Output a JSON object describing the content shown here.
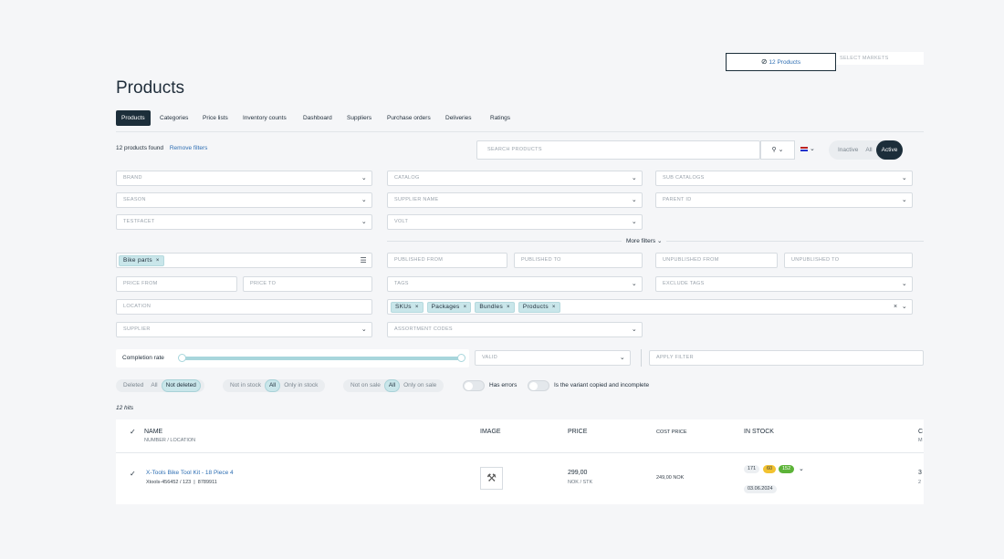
{
  "header": {
    "product_count_label": "12 Products",
    "markets_placeholder": "SELECT MARKETS"
  },
  "page_title": "Products",
  "tabs": [
    "Products",
    "Categories",
    "Price lists",
    "Inventory counts",
    "Dashboard",
    "Suppliers",
    "Purchase orders",
    "Deliveries",
    "Ratings"
  ],
  "results": {
    "found_label": "12 products found",
    "remove_filters": "Remove filters",
    "search_placeholder": "SEARCH PRODUCTS",
    "hits": "12 hits"
  },
  "status_toggle": {
    "options": [
      "Inactive",
      "All",
      "Active"
    ],
    "selected": "Active"
  },
  "filters": {
    "brand": "BRAND",
    "catalog": "CATALOG",
    "sub_catalogs": "SUB CATALOGS",
    "season": "SEASON",
    "supplier_name": "SUPPLIER NAME",
    "parent_id": "PARENT ID",
    "testfacet": "TESTFACET",
    "volt": "VOLT",
    "more_filters": "More filters",
    "category_chip": "Bike parts",
    "published_from": "PUBLISHED FROM",
    "published_to": "PUBLISHED TO",
    "unpublished_from": "UNPUBLISHED FROM",
    "unpublished_to": "UNPUBLISHED TO",
    "price_from": "PRICE FROM",
    "price_to": "PRICE TO",
    "tags": "TAGS",
    "exclude_tags": "EXCLUDE TAGS",
    "location": "LOCATION",
    "type_chips": [
      "SKUs",
      "Packages",
      "Bundles",
      "Products"
    ],
    "supplier": "SUPPLIER",
    "assortment_codes": "ASSORTMENT CODES",
    "completion_rate": "Completion rate",
    "valid": "VALID",
    "apply_filter": "APPLY FILTER"
  },
  "toggles": {
    "deleted": {
      "label": "Deleted",
      "options": [
        "All",
        "Not deleted"
      ],
      "selected": "Not deleted"
    },
    "stock": {
      "options": [
        "Not in stock",
        "All",
        "Only in stock"
      ],
      "selected": "All"
    },
    "sale": {
      "options": [
        "Not on sale",
        "All",
        "Only on sale"
      ],
      "selected": "All"
    },
    "has_errors": "Has errors",
    "variant_copied": "Is the variant copied and incomplete"
  },
  "table": {
    "col_name": "NAME",
    "col_name_sub": "NUMBER / LOCATION",
    "col_image": "IMAGE",
    "col_price": "PRICE",
    "col_cost": "COST PRICE",
    "col_stock": "IN STOCK",
    "col_extra": "C",
    "col_extra_sub": "M",
    "rows": [
      {
        "name": "X-Tools Bike Tool Kit - 18 Piece 4",
        "number": "Xtools-456452 / 123  |  8789911",
        "price": "299,00",
        "price_unit": "NOK / STK",
        "cost": "249,00 NOK",
        "stock_total": "171",
        "stock_yellow": "60",
        "stock_green": "152",
        "stock_date": "03.06.2024",
        "extra": "3",
        "extra_sub": "2"
      }
    ]
  },
  "colors": {
    "accent": "#1c2e3a",
    "chip": "#c9e6ea",
    "link": "#2f6fb3",
    "yellow": "#f2c230",
    "green": "#5cb338"
  }
}
